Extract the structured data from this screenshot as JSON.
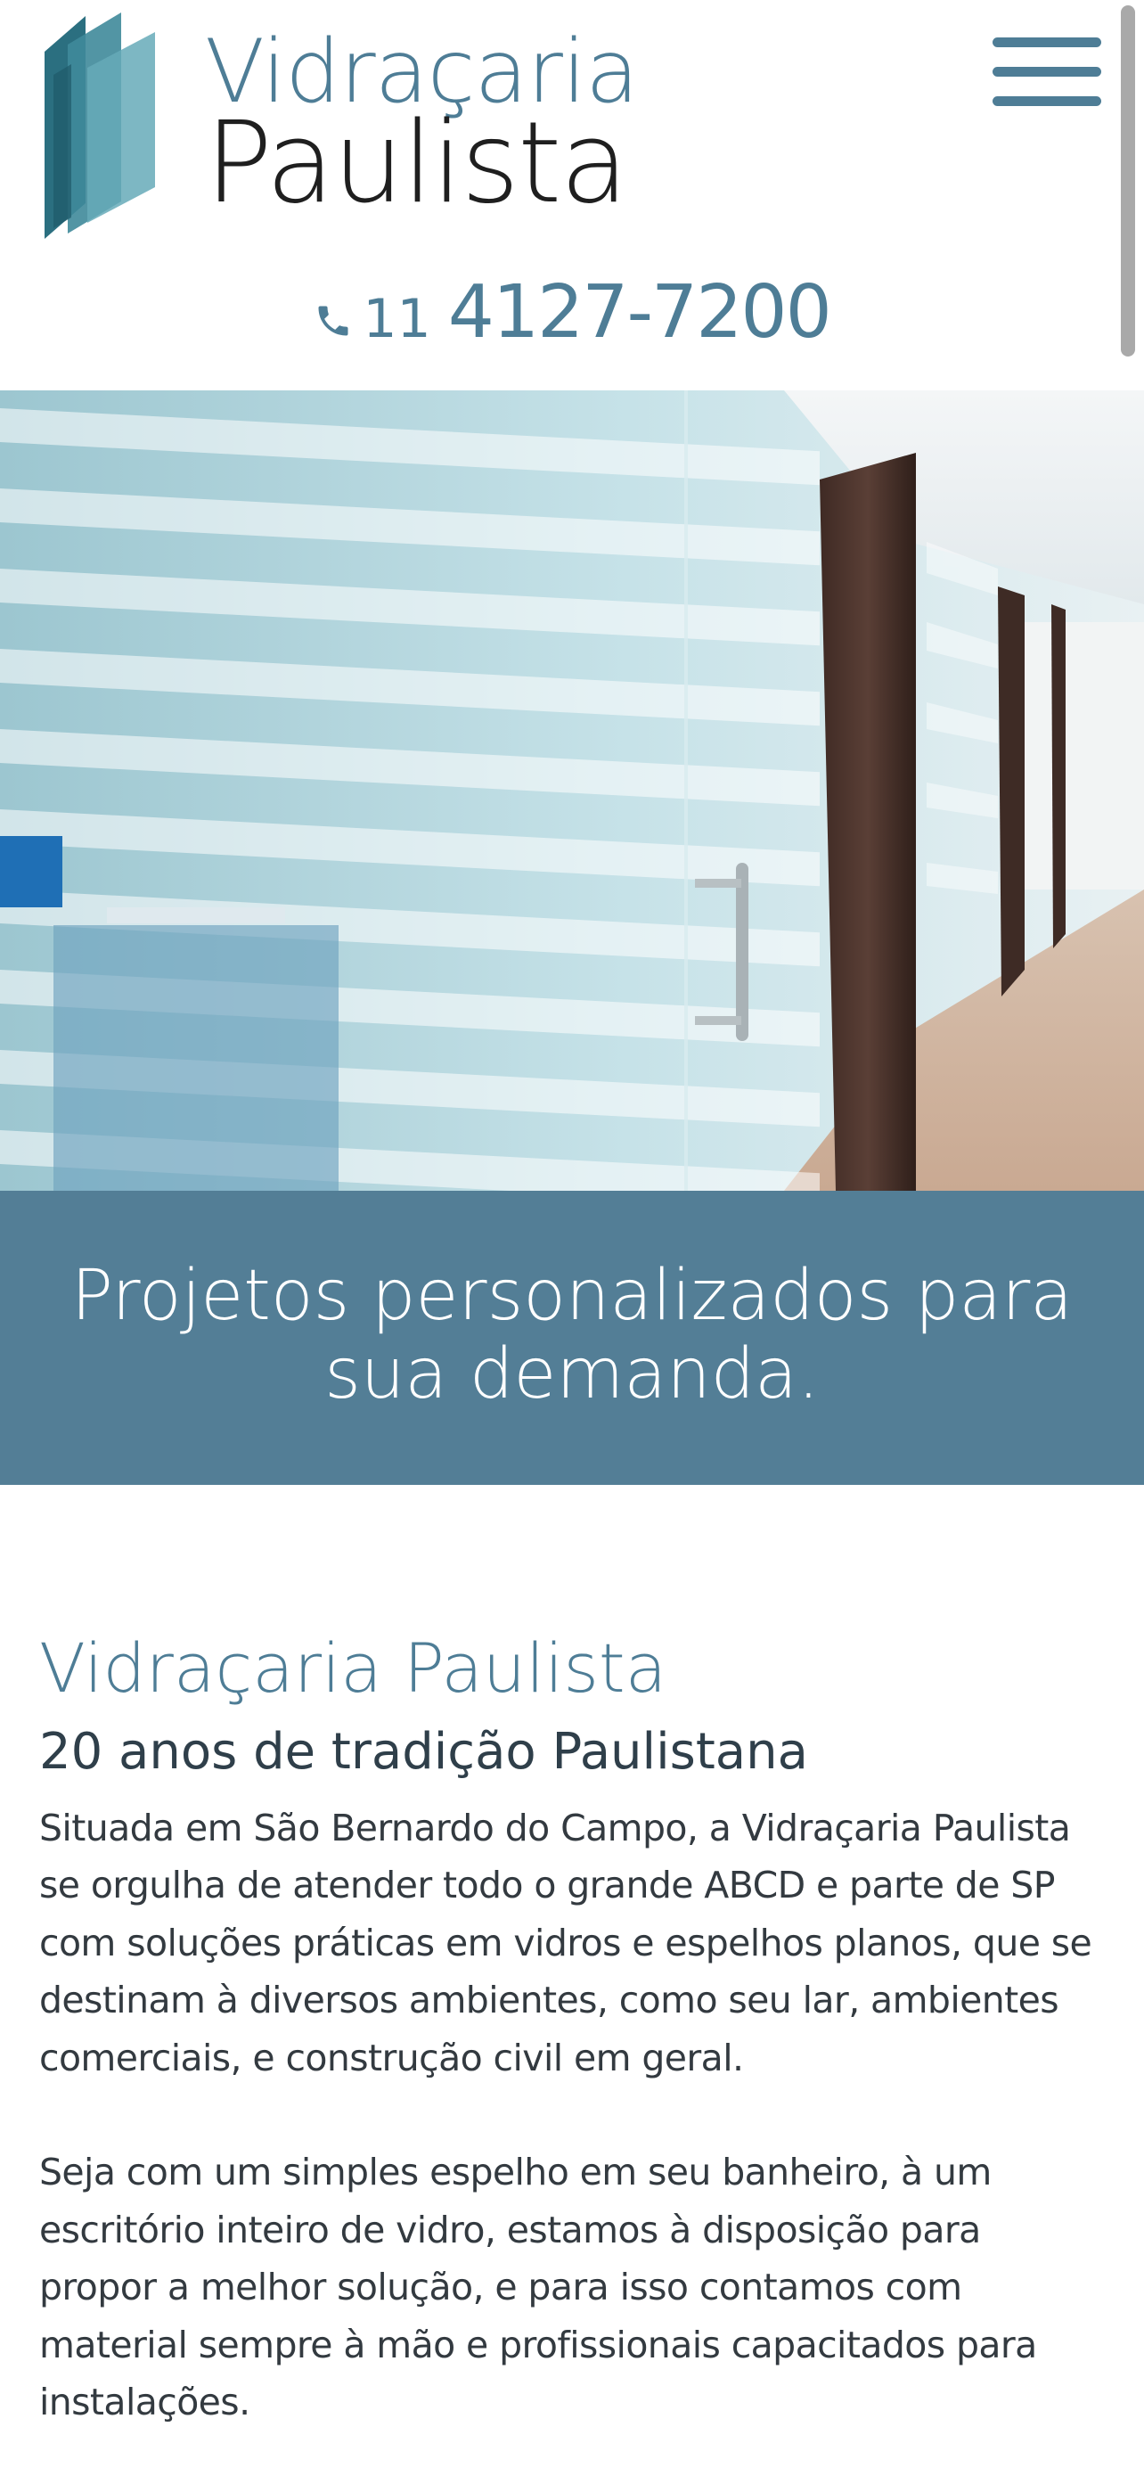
{
  "brand": {
    "name_line1": "Vidraçaria",
    "name_line2": "Paulista",
    "accent_color": "#4e7d96",
    "dark_text_color": "#1f1f1f",
    "logo_icon": "glass-panes-logo-icon"
  },
  "header": {
    "menu_icon": "hamburger-menu-icon",
    "phone_icon": "phone-icon",
    "phone_prefix": "11",
    "phone_number": "4127-7200"
  },
  "hero": {
    "image": "hero-office-glass-partitions-image"
  },
  "banner": {
    "text": "Projetos personalizados para sua demanda.",
    "background_color": "#537e96"
  },
  "content": {
    "title": "Vidraçaria Paulista",
    "subtitle": "20 anos de tradição Paulistana",
    "paragraphs": [
      "Situada em São Bernardo do Campo, a Vidraçaria Paulista se orgulha de atender todo o grande ABCD e parte de SP com soluções práticas em vidros e espelhos planos, que se destinam à diversos ambientes, como seu lar, ambientes comerciais, e construção civil em geral.",
      "Seja com um simples espelho em seu banheiro, à um escritório inteiro de vidro, estamos à disposição para propor a melhor solução, e para isso contamos com material sempre à mão e profissionais capacitados para instalações."
    ]
  }
}
